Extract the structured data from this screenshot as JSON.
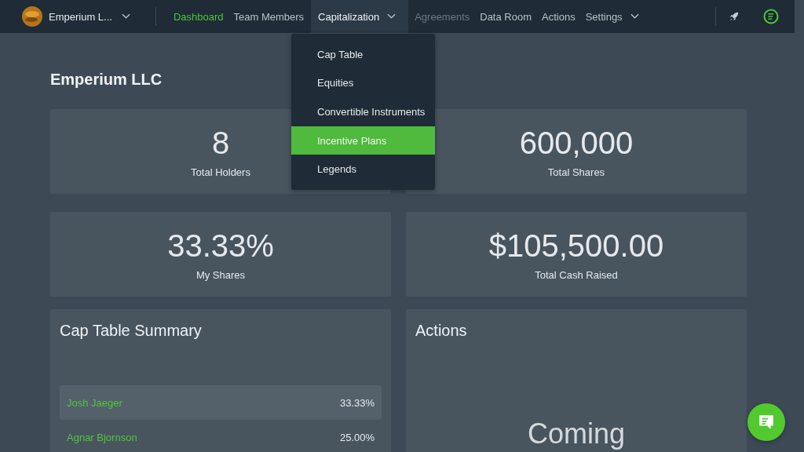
{
  "brand": {
    "name": "Emperium L..."
  },
  "nav": [
    {
      "label": "Dashboard",
      "selected": true,
      "disabled": false,
      "open": false,
      "caret": false
    },
    {
      "label": "Team Members",
      "selected": false,
      "disabled": false,
      "open": false,
      "caret": false
    },
    {
      "label": "Capitalization",
      "selected": false,
      "disabled": false,
      "open": true,
      "caret": true
    },
    {
      "label": "Agreements",
      "selected": false,
      "disabled": true,
      "open": false,
      "caret": false
    },
    {
      "label": "Data Room",
      "selected": false,
      "disabled": false,
      "open": false,
      "caret": false
    },
    {
      "label": "Actions",
      "selected": false,
      "disabled": false,
      "open": false,
      "caret": false
    },
    {
      "label": "Settings",
      "selected": false,
      "disabled": false,
      "open": false,
      "caret": true
    }
  ],
  "menu": [
    {
      "label": "Cap Table",
      "selected": false
    },
    {
      "label": "Equities",
      "selected": false
    },
    {
      "label": "Convertible Instruments",
      "selected": false
    },
    {
      "label": "Incentive Plans",
      "selected": true
    },
    {
      "label": "Legends",
      "selected": false
    }
  ],
  "org_title": "Emperium LLC",
  "stats": [
    {
      "value": "8",
      "label": "Total Holders"
    },
    {
      "value": "600,000",
      "label": "Total Shares"
    },
    {
      "value": "33.33%",
      "label": "My Shares"
    },
    {
      "value": "$105,500.00",
      "label": "Total Cash Raised"
    }
  ],
  "cap_table": {
    "title": "Cap Table Summary",
    "rows": [
      {
        "name": "Josh Jaeger",
        "percent": "33.33%",
        "highlighted": true
      },
      {
        "name": "Agnar Bjornson",
        "percent": "25.00%",
        "highlighted": false
      }
    ]
  },
  "actions": {
    "title": "Actions",
    "text": "Coming"
  }
}
